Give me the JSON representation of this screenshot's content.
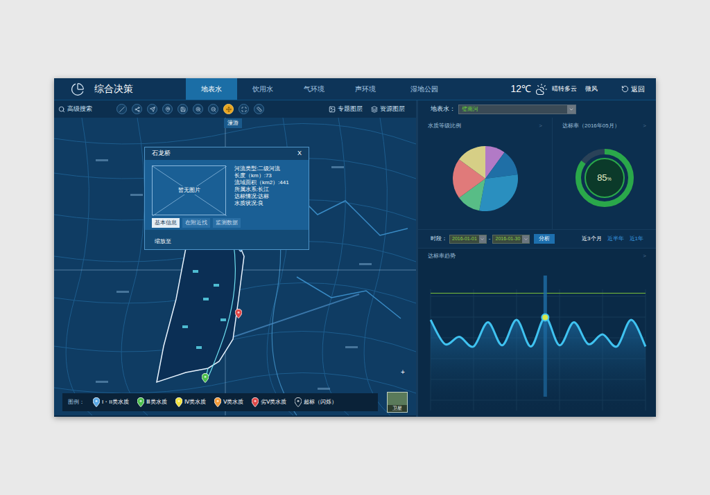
{
  "header": {
    "title": "综合决策",
    "tabs": [
      {
        "label": "地表水",
        "selected": true
      },
      {
        "label": "饮用水",
        "selected": false
      },
      {
        "label": "气环境",
        "selected": false
      },
      {
        "label": "声环境",
        "selected": false
      },
      {
        "label": "湿地公园",
        "selected": false
      }
    ],
    "temperature": "12℃",
    "weather": "晴转多云",
    "wind": "微风",
    "back": "返回"
  },
  "toolbar": {
    "search": "高级搜索",
    "tools": [
      {
        "selected": false
      },
      {
        "selected": false
      },
      {
        "selected": false
      },
      {
        "selected": false
      },
      {
        "selected": false
      },
      {
        "selected": false
      },
      {
        "selected": false
      },
      {
        "selected": true
      },
      {
        "selected": false
      },
      {
        "selected": false
      }
    ],
    "layers": [
      "专题图层",
      "资源图层"
    ]
  },
  "map": {
    "mode_tab": "漫游",
    "popup": {
      "title": "石龙桥",
      "close": "X",
      "image": "暂无图片",
      "lines": [
        "河流类型:二级河流",
        "长度（km）:73",
        "流域面积（km2）:441",
        "所属水系:长江",
        "达标情况:达标",
        "水质状况:良"
      ],
      "tabs": [
        {
          "label": "基本信息",
          "selected": true
        },
        {
          "label": "在附近找",
          "selected": false
        },
        {
          "label": "监测数据",
          "selected": false
        }
      ],
      "zoom": "缩放至"
    },
    "pins": [
      {
        "color": "#5aa9e6"
      },
      {
        "color": "#e04848"
      },
      {
        "color": "#4cc04c"
      }
    ],
    "legend": {
      "title": "图例：",
      "items": [
        {
          "label": "I・II类水质",
          "color": "#5aa9e6"
        },
        {
          "label": "Ⅲ类水质",
          "color": "#4cc04c"
        },
        {
          "label": "Ⅳ类水质",
          "color": "#f2e23a"
        },
        {
          "label": "Ⅴ类水质",
          "color": "#f29a38"
        },
        {
          "label": "劣Ⅴ类水质",
          "color": "#e04848"
        },
        {
          "label": "超标（闪烁）",
          "color": "#0a2238"
        }
      ]
    },
    "satellite": "卫星",
    "zoom_control": "+"
  },
  "right": {
    "selector": {
      "label": "地表水：",
      "value": "璧南河"
    },
    "pie_card": {
      "title": "水质等级比例",
      "more": ">",
      "slices": [
        {
          "value": 10,
          "color": "#b27ac6"
        },
        {
          "value": 13,
          "color": "#1f6fa6"
        },
        {
          "value": 30,
          "color": "#2a8fbf"
        },
        {
          "value": 12,
          "color": "#58bd86"
        },
        {
          "value": 20,
          "color": "#e07a7a"
        },
        {
          "value": 15,
          "color": "#d6cf86"
        }
      ]
    },
    "rate_card": {
      "title": "达标率（2016年05月）",
      "more": ">",
      "level": 0.85,
      "reading": "85",
      "unit": "%"
    },
    "filter": {
      "label": "时段：",
      "start": "2016-01-01",
      "separator": "-",
      "end": "2016-01-30",
      "button": "分析",
      "ranges": [
        {
          "label": "近3个月",
          "selected": true
        },
        {
          "label": "近半年",
          "selected": false
        },
        {
          "label": "近1年",
          "selected": false
        }
      ]
    },
    "trend": {
      "title": "达标率趋势",
      "more": ">",
      "values": [
        72,
        52,
        58,
        50,
        70,
        51,
        72,
        50,
        74,
        51,
        70,
        52,
        60,
        50,
        72,
        50
      ],
      "target": 94,
      "highlight_index": 8
    }
  }
}
